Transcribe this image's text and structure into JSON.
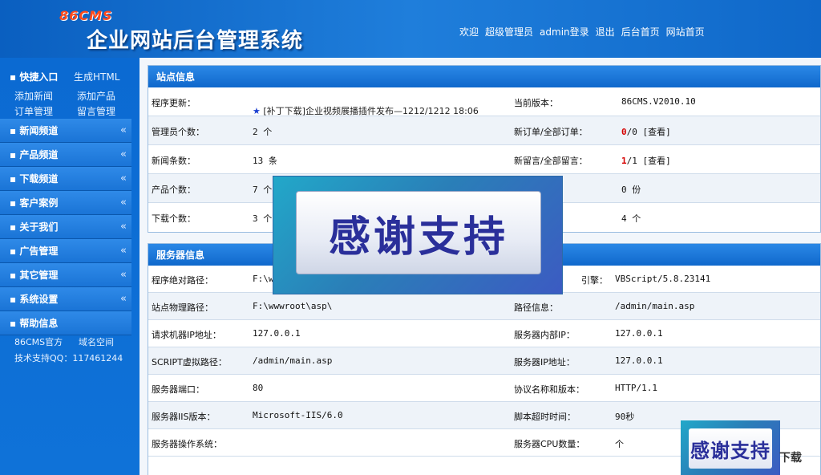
{
  "header": {
    "logo": "86CMS",
    "title": "企业网站后台管理系统",
    "links": [
      "欢迎",
      "超级管理员",
      "admin登录",
      "退出",
      "后台首页",
      "网站首页"
    ]
  },
  "sidebar": {
    "quick_title": "快捷入口",
    "quick_links": [
      "生成HTML",
      "添加新闻",
      "添加产品",
      "订单管理",
      "留言管理"
    ],
    "menu": [
      "新闻频道",
      "产品频道",
      "下载频道",
      "客户案例",
      "关于我们",
      "广告管理",
      "其它管理",
      "系统设置",
      "帮助信息"
    ],
    "chevron": "«",
    "help": [
      "86CMS官方",
      "域名空间",
      "技术支持QQ：117461244"
    ]
  },
  "site_info": {
    "title": "站点信息",
    "rows": [
      {
        "l1": "程序更新：",
        "v1": "[补丁下载]企业视频展播插件发布—1212/1212 18:06",
        "l2": "当前版本：",
        "v2": "86CMS.V2010.10"
      },
      {
        "l1": "管理员个数：",
        "v1": "2 个",
        "l2": "新订单/全部订单：",
        "v2a": "0",
        "v2b": "/0 [查看]"
      },
      {
        "l1": "新闻条数：",
        "v1": "13 条",
        "l2": "新留言/全部留言：",
        "v2a": "1",
        "v2b": "/1 [查看]"
      },
      {
        "l1": "产品个数：",
        "v1": "7 个",
        "v2": "0 份"
      },
      {
        "l1": "下载个数：",
        "v1": "3 个",
        "v2": "4 个"
      }
    ]
  },
  "server_info": {
    "title": "服务器信息",
    "rows": [
      {
        "l1": "程序绝对路径：",
        "v1": "F:\\w",
        "l2": "引擎：",
        "v2": "VBScript/5.8.23141"
      },
      {
        "l1": "站点物理路径：",
        "v1": "F:\\wwwroot\\asp\\",
        "l2": "路径信息：",
        "v2": "/admin/main.asp"
      },
      {
        "l1": "请求机器IP地址：",
        "v1": "127.0.0.1",
        "l2": "服务器内部IP：",
        "v2": "127.0.0.1"
      },
      {
        "l1": "SCRIPT虚拟路径：",
        "v1": "/admin/main.asp",
        "l2": "服务器IP地址：",
        "v2": "127.0.0.1"
      },
      {
        "l1": "服务器端口：",
        "v1": "80",
        "l2": "协议名称和版本：",
        "v2": "HTTP/1.1"
      },
      {
        "l1": "服务器IIS版本：",
        "v1": "Microsoft-IIS/6.0",
        "l2": "脚本超时时间：",
        "v2": "90秒"
      },
      {
        "l1": "服务器操作系统：",
        "v1": "",
        "l2": "服务器CPU数量：",
        "v2": "个"
      }
    ]
  },
  "overlays": {
    "thanks": "感谢支持",
    "watermark": "下载"
  },
  "colors": {
    "header_blue": "#0f68c9",
    "accent_red": "#d60000"
  }
}
